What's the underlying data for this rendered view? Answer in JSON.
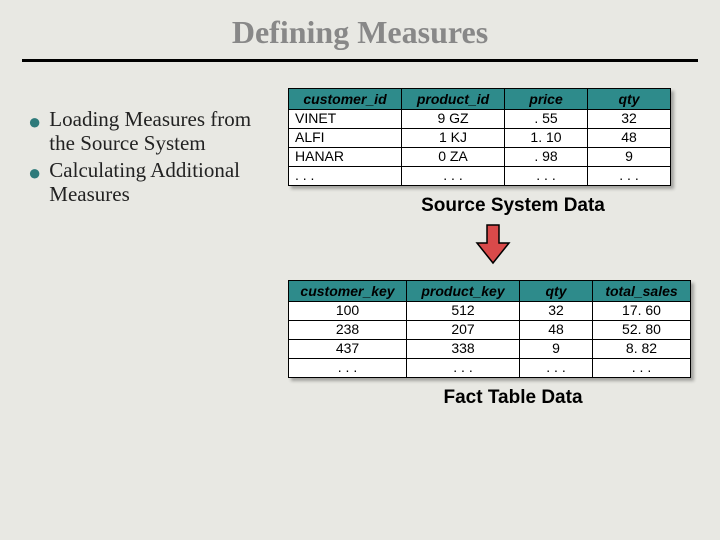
{
  "title": "Defining Measures",
  "bullets": [
    "Loading Measures from the Source System",
    "Calculating Additional Measures"
  ],
  "table1": {
    "headers": [
      "customer_id",
      "product_id",
      "price",
      "qty"
    ],
    "rows": [
      [
        "VINET",
        "9 GZ",
        ". 55",
        "32"
      ],
      [
        "ALFI",
        "1 KJ",
        "1. 10",
        "48"
      ],
      [
        "HANAR",
        "0 ZA",
        ". 98",
        "9"
      ],
      [
        ". . .",
        ". . .",
        ". . .",
        ". . ."
      ]
    ],
    "caption": "Source System Data"
  },
  "table2": {
    "headers": [
      "customer_key",
      "product_key",
      "qty",
      "total_sales"
    ],
    "rows": [
      [
        "100",
        "512",
        "32",
        "17. 60"
      ],
      [
        "238",
        "207",
        "48",
        "52. 80"
      ],
      [
        "437",
        "338",
        "9",
        "8. 82"
      ],
      [
        ". . .",
        ". . .",
        ". . .",
        ". . ."
      ]
    ],
    "caption": "Fact Table Data"
  }
}
